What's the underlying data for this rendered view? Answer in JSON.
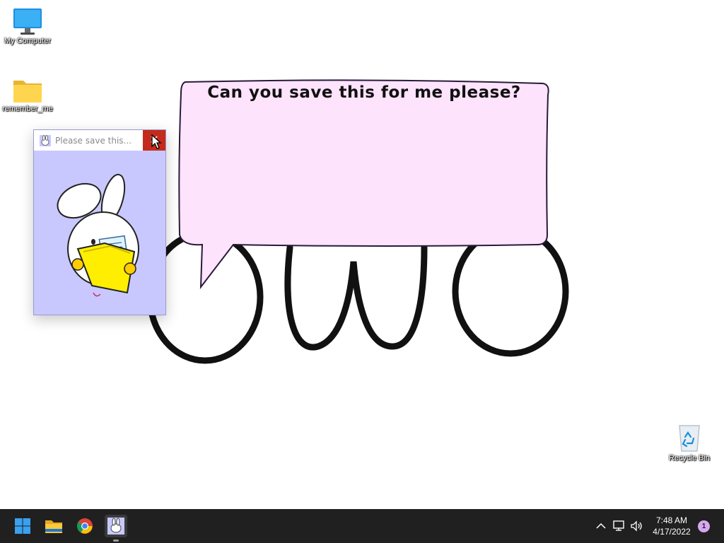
{
  "desktop": {
    "icons": [
      {
        "label": "My Computer",
        "icon": "monitor-icon"
      },
      {
        "label": "remember_me",
        "icon": "folder-icon"
      },
      {
        "label": "Recycle Bin",
        "icon": "recycle-bin-icon"
      }
    ],
    "speech_bubble": {
      "text": "Can you save this for me please?"
    },
    "background_art": "owo-face"
  },
  "popup_window": {
    "title": "Please save this...",
    "close_label": "✕",
    "bg_color": "#c8c8ff",
    "close_color": "#c42b1c",
    "art": "bunny-holding-folder"
  },
  "taskbar": {
    "apps": [
      {
        "name": "Start",
        "icon": "windows-start-icon"
      },
      {
        "name": "File Explorer",
        "icon": "file-explorer-icon"
      },
      {
        "name": "Google Chrome",
        "icon": "chrome-icon"
      },
      {
        "name": "Bunny app",
        "icon": "bunny-app-icon"
      }
    ],
    "tray": [
      "chevron-up-icon",
      "network-icon",
      "volume-icon"
    ],
    "clock": {
      "time": "7:48 AM",
      "date": "4/17/2022"
    },
    "notifications": "1"
  }
}
